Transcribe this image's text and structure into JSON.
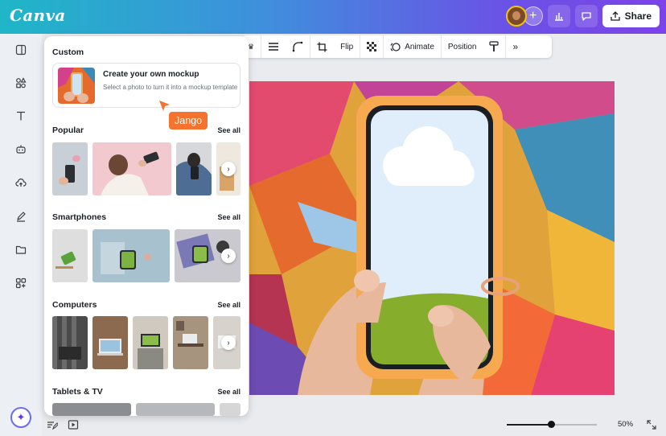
{
  "app": {
    "logo": "Canva"
  },
  "header": {
    "share_label": "Share",
    "icons": [
      "add-icon",
      "bar-chart-icon",
      "comment-icon",
      "share-icon"
    ]
  },
  "toolbar": {
    "flip_label": "Flip",
    "animate_label": "Animate",
    "position_label": "Position"
  },
  "panel": {
    "custom": {
      "title": "Custom",
      "card_title": "Create your own mockup",
      "card_desc": "Select a photo to turn it into a mockup template"
    },
    "sections": [
      {
        "title": "Popular",
        "see_all": "See all"
      },
      {
        "title": "Smartphones",
        "see_all": "See all"
      },
      {
        "title": "Computers",
        "see_all": "See all"
      },
      {
        "title": "Tablets & TV",
        "see_all": "See all"
      }
    ]
  },
  "cursor": {
    "user_label": "Jango",
    "color": "#f5732e"
  },
  "zoom": {
    "value_label": "50%",
    "level": 0.5
  },
  "colors": {
    "brand_start": "#1fb6c7",
    "brand_end": "#7c43e8",
    "phone_case": "#f7a94f"
  }
}
